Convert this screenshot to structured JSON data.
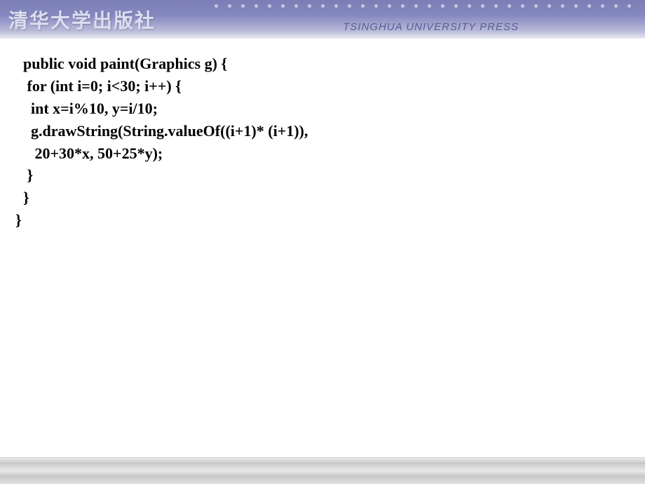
{
  "header": {
    "logo": "清华大学出版社",
    "subtitle": "TSINGHUA UNIVERSITY PRESS"
  },
  "code": {
    "lines": [
      "  public void paint(Graphics g) {",
      "   for (int i=0; i<30; i++) {",
      "    int x=i%10, y=i/10;",
      "    g.drawString(String.valueOf((i+1)* (i+1)),",
      "     20+30*x, 50+25*y);",
      "   }",
      "  }",
      "}"
    ]
  }
}
